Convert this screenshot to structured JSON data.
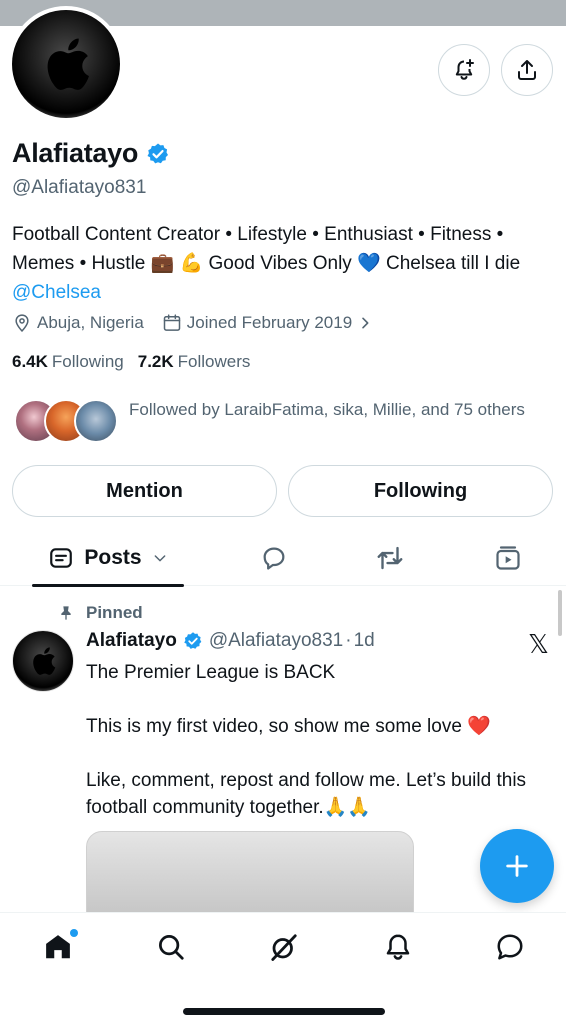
{
  "profile": {
    "display_name": "Alafiatayo",
    "handle": "@Alafiatayo831",
    "bio_text": "Football Content Creator • Lifestyle • Enthusiast • Fitness • Memes • Hustle 💼 💪 Good Vibes Only 💙 Chelsea till I die ",
    "bio_link": "@Chelsea",
    "location": "Abuja, Nigeria",
    "joined": "Joined February 2019",
    "following_count": "6.4K",
    "following_label": "Following",
    "followers_count": "7.2K",
    "followers_label": "Followers",
    "followed_by": "Followed by LaraibFatima, sika, Millie, and 75 others"
  },
  "actions": {
    "mention_label": "Mention",
    "following_label": "Following"
  },
  "tabs": {
    "posts_label": "Posts"
  },
  "pinned_post": {
    "pinned_label": "Pinned",
    "author_name": "Alafiatayo",
    "author_handle": "@Alafiatayo831",
    "separator": "·",
    "time": "1d",
    "line1": "The Premier League is BACK",
    "line2": "This is my first video, so show me some love ❤️",
    "line3": "Like, comment, repost and follow me. Let’s build this football community together.🙏🙏"
  },
  "colors": {
    "accent": "#1d9bf0",
    "text_primary": "#0f1419",
    "text_secondary": "#536471",
    "border": "#cfd9de"
  },
  "icons": {
    "notification_bell_plus": "bell-plus-icon",
    "share": "share-icon",
    "verified": "verified-badge-icon",
    "location": "location-pin-icon",
    "calendar": "calendar-icon",
    "posts_tab": "posts-icon",
    "replies_tab": "reply-icon",
    "reposts_tab": "repost-icon",
    "media_tab": "video-icon",
    "pin": "pin-icon",
    "x_logo": "x-logo-icon",
    "compose": "plus-icon",
    "nav": [
      "home-icon",
      "search-icon",
      "grok-icon",
      "notifications-icon",
      "messages-icon"
    ]
  }
}
